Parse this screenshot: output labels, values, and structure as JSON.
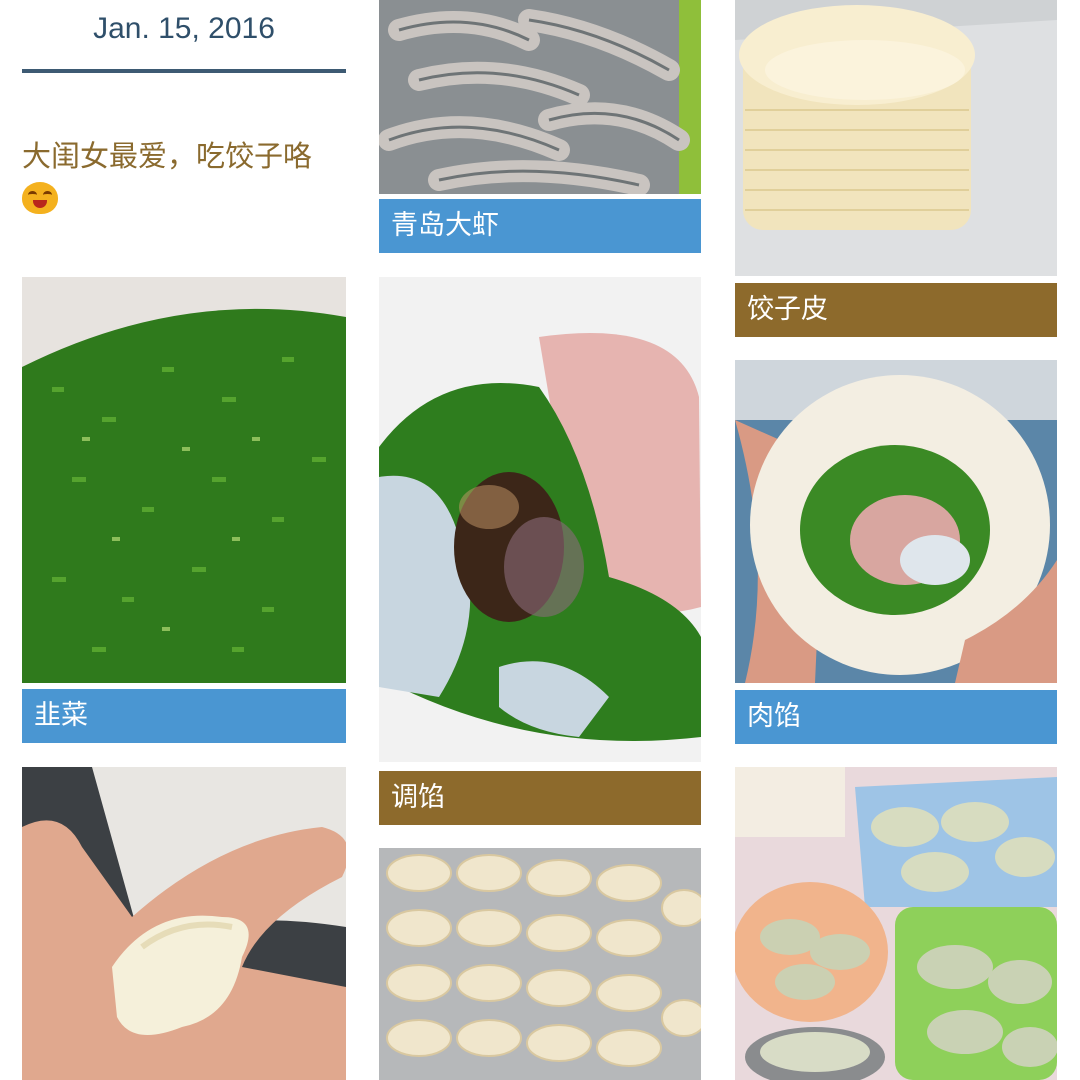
{
  "header": {
    "date": "Jan. 15, 2016",
    "caption": "大闺女最爱，吃饺子咯",
    "emoji": "smiling-face-emoji"
  },
  "tiles": [
    {
      "label": "青岛大虾",
      "label_color": "#4a96d2",
      "photo": "raw-shrimp"
    },
    {
      "label": "饺子皮",
      "label_color": "#8d6a2c",
      "photo": "dumpling-wrappers"
    },
    {
      "label": "韭菜",
      "label_color": "#4a96d2",
      "photo": "chopped-chives"
    },
    {
      "label": "调馅",
      "label_color": "#8d6a2c",
      "photo": "filling-bowl"
    },
    {
      "label": "肉馅",
      "label_color": "#4a96d2",
      "photo": "filling-on-wrapper"
    }
  ],
  "unlabeled_photos": [
    "dumpling-in-hand",
    "tray-of-dumplings",
    "plated-dumplings"
  ]
}
